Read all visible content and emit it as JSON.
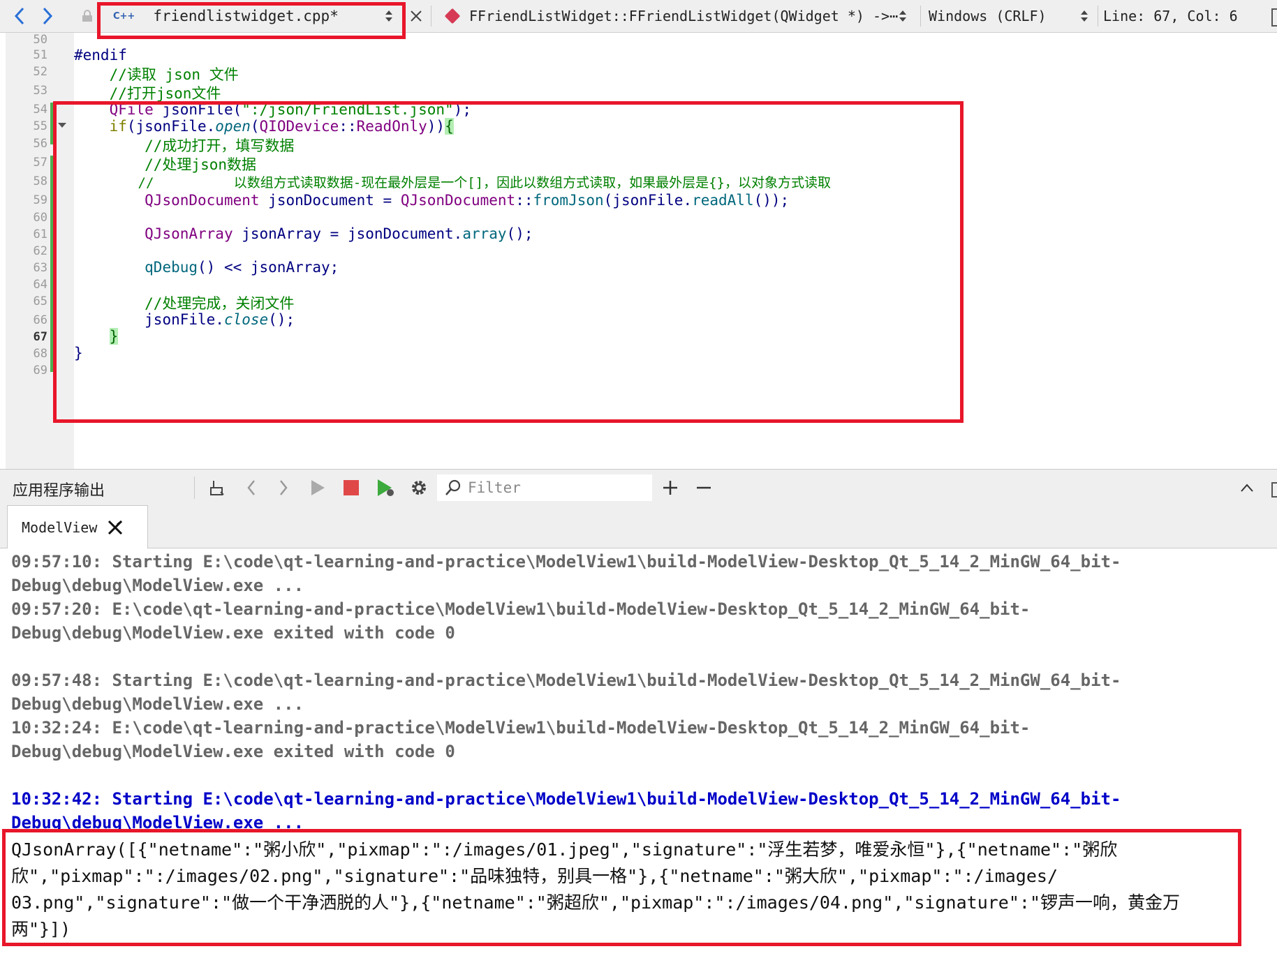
{
  "toolbar": {
    "file_type_badge": "C++",
    "file_name": "friendlistwidget.cpp*",
    "symbol": "FFriendListWidget::FFriendListWidget(QWidget *) ->⋯",
    "encoding": "Windows (CRLF)",
    "cursor_position": "Line: 67, Col: 6"
  },
  "editor": {
    "line_numbers": [
      "50",
      "51",
      "52",
      "53",
      "54",
      "55",
      "56",
      "57",
      "58",
      "59",
      "60",
      "61",
      "62",
      "63",
      "64",
      "65",
      "66",
      "67",
      "68",
      "69"
    ],
    "current_line": "67",
    "lines": {
      "l51": "#endif",
      "l52": "    //读取 json 文件",
      "l53": "    //打开json文件",
      "l54_a": "    ",
      "l54_type": "QFile",
      "l54_b": " jsonFile(",
      "l54_str": "\":/json/FriendList.json\"",
      "l54_c": ");",
      "l55_kw": "    if",
      "l55_a": "(jsonFile.",
      "l55_fn": "open",
      "l55_b": "(",
      "l55_type": "QIODevice",
      "l55_c": "::",
      "l55_enum": "ReadOnly",
      "l55_d": "))",
      "l55_brace": "{",
      "l56": "        //成功打开，填写数据",
      "l57": "        //处理json数据",
      "l58": "        //          以数组方式读取数据-现在最外层是一个[]，因此以数组方式读取，如果最外层是{}，以对象方式读取",
      "l59_type1": "QJsonDocument",
      "l59_a": " jsonDocument = ",
      "l59_type2": "QJsonDocument",
      "l59_b": "::",
      "l59_fn": "fromJson",
      "l59_c": "(jsonFile.",
      "l59_fn2": "readAll",
      "l59_d": "());",
      "l61_type": "QJsonArray",
      "l61_a": " jsonArray = jsonDocument.",
      "l61_fn": "array",
      "l61_b": "();",
      "l63_fn": "qDebug",
      "l63_a": "() << jsonArray;",
      "l65": "        //处理完成，关闭文件",
      "l66_a": "jsonFile.",
      "l66_fn": "close",
      "l66_b": "();",
      "l67_brace": "}",
      "l68": "}"
    }
  },
  "output_pane": {
    "title": "应用程序输出",
    "filter_placeholder": "Filter",
    "tab_label": "ModelView"
  },
  "output": {
    "runs": [
      {
        "l1": "09:57:10: Starting E:\\code\\qt-learning-and-practice\\ModelView1\\build-ModelView-Desktop_Qt_5_14_2_MinGW_64_bit-",
        "l2": "Debug\\debug\\ModelView.exe ..."
      },
      {
        "l1": "09:57:20: E:\\code\\qt-learning-and-practice\\ModelView1\\build-ModelView-Desktop_Qt_5_14_2_MinGW_64_bit-",
        "l2": "Debug\\debug\\ModelView.exe exited with code 0"
      },
      {
        "l1": "09:57:48: Starting E:\\code\\qt-learning-and-practice\\ModelView1\\build-ModelView-Desktop_Qt_5_14_2_MinGW_64_bit-",
        "l2": "Debug\\debug\\ModelView.exe ..."
      },
      {
        "l1": "10:32:24: E:\\code\\qt-learning-and-practice\\ModelView1\\build-ModelView-Desktop_Qt_5_14_2_MinGW_64_bit-",
        "l2": "Debug\\debug\\ModelView.exe exited with code 0"
      },
      {
        "l1": "10:32:42: Starting E:\\code\\qt-learning-and-practice\\ModelView1\\build-ModelView-Desktop_Qt_5_14_2_MinGW_64_bit-",
        "l2": "Debug\\debug\\ModelView.exe ..."
      }
    ],
    "json_lines": [
      "QJsonArray([{\"netname\":\"粥小欣\",\"pixmap\":\":/images/01.jpeg\",\"signature\":\"浮生若梦，唯爱永恒\"},{\"netname\":\"粥欣",
      "欣\",\"pixmap\":\":/images/02.png\",\"signature\":\"品味独特，别具一格\"},{\"netname\":\"粥大欣\",\"pixmap\":\":/images/",
      "03.png\",\"signature\":\"做一个干净洒脱的人\"},{\"netname\":\"粥超欣\",\"pixmap\":\":/images/04.png\",\"signature\":\"锣声一响，黄金万",
      "两\"}])"
    ]
  },
  "colors": {
    "highlight_frame": "#e8162a",
    "latest_run_text": "#0000c8",
    "previous_run_text": "#666666",
    "symbol_icon": "#d63a55",
    "change_bar": "#4caf50"
  }
}
